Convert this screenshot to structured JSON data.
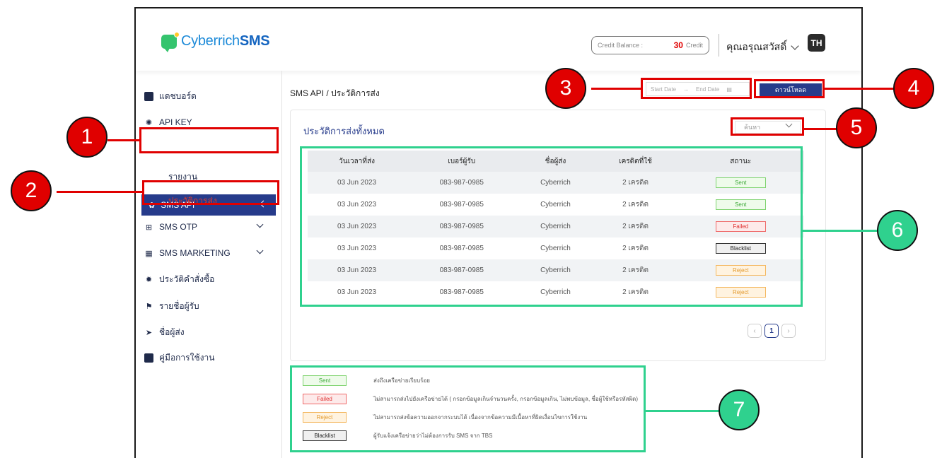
{
  "header": {
    "logo_plain": "Cyberrich",
    "logo_bold": "SMS",
    "credit_label": "Credit Balance :",
    "credit_value": "30",
    "credit_unit": "Credit",
    "user_name": "คุณอรุณสวัสดิ์",
    "language": "TH"
  },
  "sidebar": {
    "items": [
      {
        "label": "แดชบอร์ด",
        "icon": "dashboard-icon"
      },
      {
        "label": "API KEY",
        "icon": "key-icon"
      },
      {
        "label": "SMS API",
        "icon": "api-icon"
      },
      {
        "label": "รายงาน"
      },
      {
        "label": "ประวัติการส่ง"
      },
      {
        "label": "SMS OTP",
        "icon": "otp-icon"
      },
      {
        "label": "SMS MARKETING",
        "icon": "marketing-icon"
      },
      {
        "label": "ประวัติคำสั่งซื้อ",
        "icon": "gear-icon"
      },
      {
        "label": "รายชื่อผู้รับ",
        "icon": "contacts-icon"
      },
      {
        "label": "ชื่อผู้ส่ง",
        "icon": "send-icon"
      },
      {
        "label": "คู่มือการใช้งาน",
        "icon": "book-icon"
      }
    ]
  },
  "main": {
    "breadcrumb": "SMS API / ประวัติการส่ง",
    "start_date": "Start Date",
    "date_sep": "→",
    "end_date": "End Date",
    "download_label": "ดาวน์โหลด",
    "card_title": "ประวัติการส่งทั้งหมด",
    "search_label": "ค้นหา",
    "table": {
      "headers": [
        "วันเวลาที่ส่ง",
        "เบอร์ผู้รับ",
        "ชื่อผู้ส่ง",
        "เครดิตที่ใช้",
        "สถานะ"
      ],
      "rows": [
        [
          "03 Jun 2023",
          "083-987-0985",
          "Cyberrich",
          "2 เครดิต",
          "Sent"
        ],
        [
          "03 Jun 2023",
          "083-987-0985",
          "Cyberrich",
          "2 เครดิต",
          "Sent"
        ],
        [
          "03 Jun 2023",
          "083-987-0985",
          "Cyberrich",
          "2 เครดิต",
          "Failed"
        ],
        [
          "03 Jun 2023",
          "083-987-0985",
          "Cyberrich",
          "2 เครดิต",
          "Blacklist"
        ],
        [
          "03 Jun 2023",
          "083-987-0985",
          "Cyberrich",
          "2 เครดิต",
          "Reject"
        ],
        [
          "03 Jun 2023",
          "083-987-0985",
          "Cyberrich",
          "2 เครดิต",
          "Reject"
        ]
      ]
    },
    "pagination": {
      "current": "1",
      "prev": "‹",
      "next": "›"
    }
  },
  "legend": [
    {
      "status": "Sent",
      "desc": "ส่งถึงเครือข่ายเรียบร้อย"
    },
    {
      "status": "Failed",
      "desc": "ไม่สามารถส่งไปยังเครือข่ายได้ ( กรอกข้อมูลเกินจำนวนครั้ง, กรอกข้อมูลเกิน, ไม่พบข้อมูล, ชื่อผู้ใช้หรือรหัสผิด)"
    },
    {
      "status": "Reject",
      "desc": "ไม่สามารถส่งข้อความออกจากระบบได้ เนื่องจากข้อความมีเนื้อหาที่ผิดเงื่อนไขการใช้งาน"
    },
    {
      "status": "Blacklist",
      "desc": "ผู้รับแจ้งเครือข่ายว่าไม่ต้องการรับ SMS จาก TBS"
    }
  ],
  "callouts": [
    "1",
    "2",
    "3",
    "4",
    "5",
    "6",
    "7"
  ],
  "colors": {
    "primary": "#263b8b",
    "highlight_red": "#e00000",
    "highlight_green": "#2fd18e",
    "sent": "#4caf50",
    "failed": "#e53935",
    "reject": "#f0a030",
    "blacklist": "#333333"
  }
}
